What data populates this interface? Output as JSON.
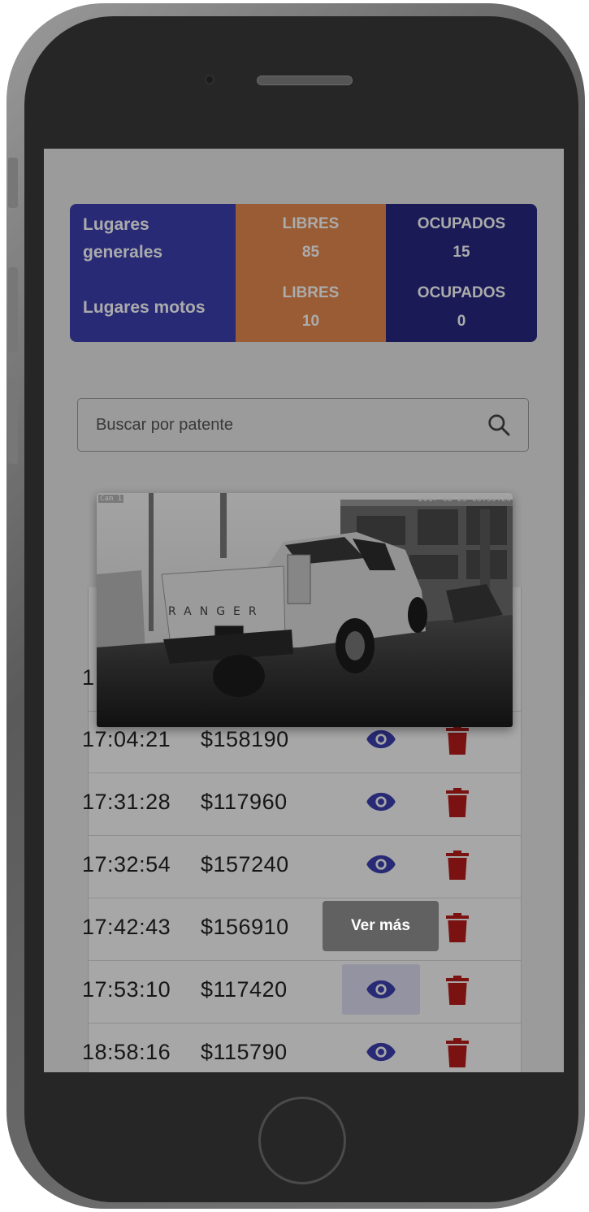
{
  "stats": {
    "general": {
      "label": "Lugares generales",
      "free_label": "LIBRES",
      "free_value": "85",
      "occupied_label": "OCUPADOS",
      "occupied_value": "15"
    },
    "motos": {
      "label": "Lugares motos",
      "free_label": "LIBRES",
      "free_value": "10",
      "occupied_label": "OCUPADOS",
      "occupied_value": "0"
    }
  },
  "search": {
    "placeholder": "Buscar por patente",
    "value": ""
  },
  "photo": {
    "cam_label": "Cam 1",
    "timestamp": "2017-08-29 05:39:26",
    "plate_text": "RANGER"
  },
  "partial_row_char": "1",
  "rows": [
    {
      "time": "17:04:21",
      "amount": "$158190"
    },
    {
      "time": "17:31:28",
      "amount": "$117960"
    },
    {
      "time": "17:32:54",
      "amount": "$157240"
    },
    {
      "time": "17:42:43",
      "amount": "$156910"
    },
    {
      "time": "17:53:10",
      "amount": "$117420"
    },
    {
      "time": "18:58:16",
      "amount": "$115790"
    }
  ],
  "tooltip": {
    "text": "Ver más"
  },
  "colors": {
    "primary": "#3c3fb0",
    "free": "#e58a4e",
    "occupied": "#262780",
    "delete": "#b71c1c",
    "view": "#3c3fb0"
  }
}
